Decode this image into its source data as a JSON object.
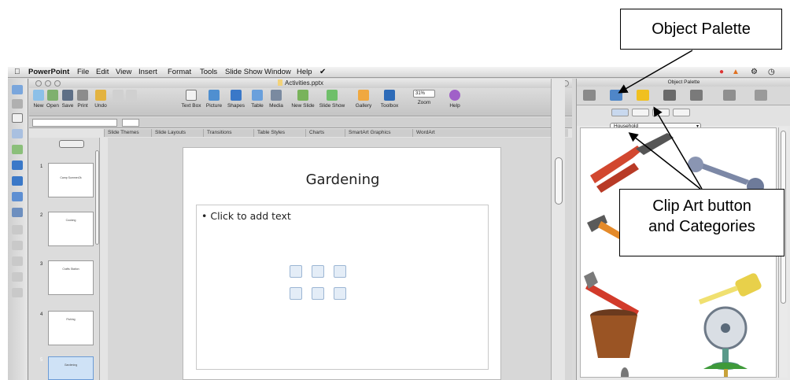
{
  "callouts": {
    "object_palette": "Object Palette",
    "clip_art_line1": "Clip Art button",
    "clip_art_line2": "and Categories"
  },
  "menubar": {
    "app_name": "PowerPoint",
    "items": [
      "File",
      "Edit",
      "View",
      "Insert",
      "Format",
      "Tools",
      "Slide Show",
      "Window",
      "Help"
    ]
  },
  "window": {
    "title": "Activities.pptx"
  },
  "toolbar": {
    "buttons": [
      "New",
      "Open",
      "Save",
      "Print",
      "Undo",
      "Text Box",
      "Picture",
      "Shapes",
      "Table",
      "Media",
      "New Slide",
      "Slide Show",
      "Gallery",
      "Toolbox",
      "Zoom",
      "Help"
    ],
    "zoom_value": "31%"
  },
  "ribbon": {
    "tabs": [
      "Slide Themes",
      "Slide Layouts",
      "Transitions",
      "Table Styles",
      "Charts",
      "SmartArt Graphics",
      "WordArt"
    ]
  },
  "thumbnails": [
    {
      "number": "1",
      "text": "Camp Summer2k"
    },
    {
      "number": "2",
      "text": "Cooking"
    },
    {
      "number": "3",
      "text": "Crafts Station"
    },
    {
      "number": "4",
      "text": "Fishing"
    },
    {
      "number": "5",
      "text": "Gardening"
    }
  ],
  "slide": {
    "title": "Gardening",
    "body_placeholder": "• Click to add text"
  },
  "object_palette": {
    "title": "Object Palette",
    "category": "Household"
  },
  "colors": {
    "accent_blue": "#3a78c8",
    "selection_blue": "#cfe2f6",
    "callout_border": "#000000"
  }
}
